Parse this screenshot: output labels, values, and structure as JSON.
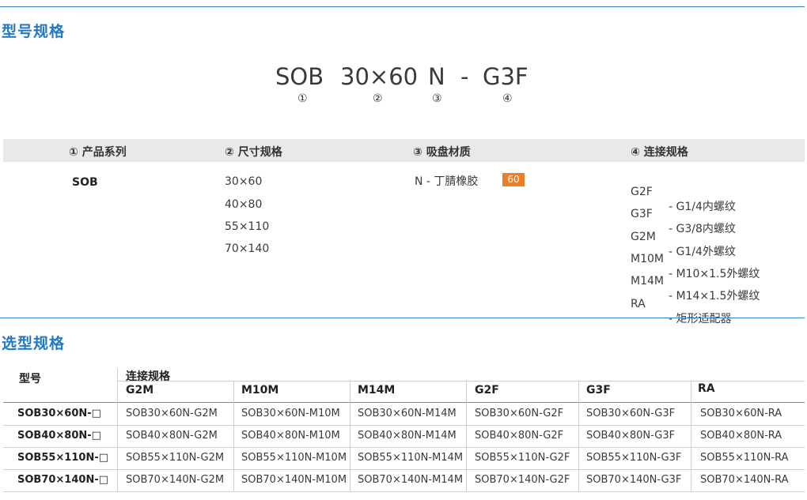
{
  "section1": {
    "title": "型号规格"
  },
  "code": {
    "parts": [
      "SOB",
      "30×60",
      "N",
      "-",
      "G3F"
    ],
    "markers": [
      "①",
      "②",
      "③",
      "④"
    ]
  },
  "headers": [
    "① 产品系列",
    "② 尺寸规格",
    "③ 吸盘材质",
    "④ 连接规格"
  ],
  "series": "SOB",
  "sizes": [
    "30×60",
    "40×80",
    "55×110",
    "70×140"
  ],
  "material": {
    "label": "N - 丁腈橡胶",
    "badge": "60",
    "badge_color": "#f07c24"
  },
  "connections": [
    {
      "code": "G2F",
      "desc": "- G1/4内螺纹"
    },
    {
      "code": "G3F",
      "desc": "- G3/8内螺纹"
    },
    {
      "code": "G2M",
      "desc": "- G1/4外螺纹"
    },
    {
      "code": "M10M",
      "desc": "- M10×1.5外螺纹"
    },
    {
      "code": "M14M",
      "desc": "- M14×1.5外螺纹"
    },
    {
      "code": "RA",
      "desc": "- 矩形适配器"
    }
  ],
  "section2": {
    "title": "选型规格"
  },
  "table": {
    "model_header": "型号",
    "group_header": "连接规格",
    "columns": [
      "G2M",
      "M10M",
      "M14M",
      "G2F",
      "G3F",
      "RA"
    ],
    "rows": [
      {
        "model": "SOB30×60N-□",
        "cells": [
          "SOB30×60N-G2M",
          "SOB30×60N-M10M",
          "SOB30×60N-M14M",
          "SOB30×60N-G2F",
          "SOB30×60N-G3F",
          "SOB30×60N-RA"
        ]
      },
      {
        "model": "SOB40×80N-□",
        "cells": [
          "SOB40×80N-G2M",
          "SOB40×80N-M10M",
          "SOB40×80N-M14M",
          "SOB40×80N-G2F",
          "SOB40×80N-G3F",
          "SOB40×80N-RA"
        ]
      },
      {
        "model": "SOB55×110N-□",
        "cells": [
          "SOB55×110N-G2M",
          "SOB55×110N-M10M",
          "SOB55×110N-M14M",
          "SOB55×110N-G2F",
          "SOB55×110N-G3F",
          "SOB55×110N-RA"
        ]
      },
      {
        "model": "SOB70×140N-□",
        "cells": [
          "SOB70×140N-G2M",
          "SOB70×140N-M10M",
          "SOB70×140N-M14M",
          "SOB70×140N-G2F",
          "SOB70×140N-G3F",
          "SOB70×140N-RA"
        ]
      }
    ]
  },
  "colors": {
    "accent": "#1f78c8",
    "rule": "#2f7fc6",
    "header_band": "#e9e9e9"
  }
}
